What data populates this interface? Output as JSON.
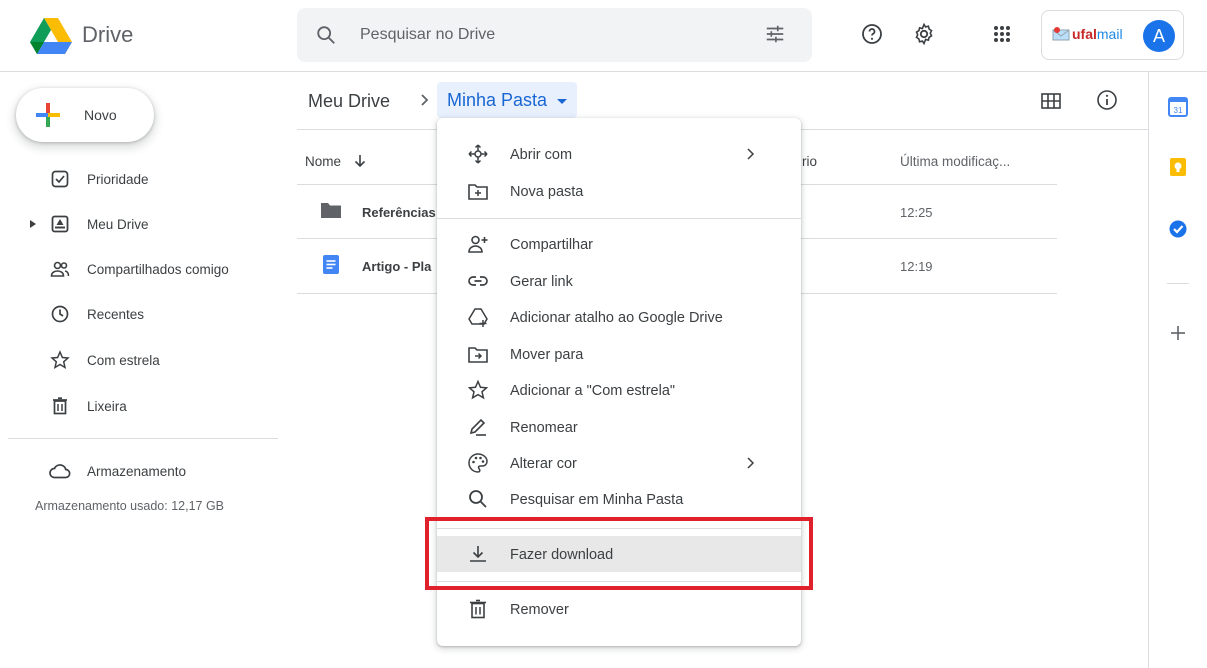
{
  "header": {
    "app_name": "Drive",
    "search_placeholder": "Pesquisar no Drive",
    "account_brand_a": "ufal",
    "account_brand_b": "mail",
    "avatar_letter": "A"
  },
  "sidebar": {
    "new_label": "Novo",
    "items": [
      {
        "label": "Prioridade",
        "icon": "priority-icon"
      },
      {
        "label": "Meu Drive",
        "icon": "my-drive-icon"
      },
      {
        "label": "Compartilhados comigo",
        "icon": "shared-icon"
      },
      {
        "label": "Recentes",
        "icon": "clock-icon"
      },
      {
        "label": "Com estrela",
        "icon": "star-icon"
      },
      {
        "label": "Lixeira",
        "icon": "trash-icon"
      },
      {
        "label": "Armazenamento",
        "icon": "cloud-icon"
      }
    ],
    "storage_text": "Armazenamento usado: 12,17 GB"
  },
  "breadcrumb": {
    "root": "Meu Drive",
    "current": "Minha Pasta"
  },
  "table": {
    "col_name": "Nome",
    "col_owner_partial": "rio",
    "col_modified": "Última modificaç...",
    "rows": [
      {
        "name": "Referências",
        "time": "12:25",
        "icon": "folder-icon"
      },
      {
        "name": "Artigo - Pla",
        "time": "12:19",
        "icon": "doc-icon"
      }
    ]
  },
  "menu": {
    "items": [
      {
        "label": "Abrir com",
        "icon": "open-with-icon",
        "submenu": true
      },
      {
        "label": "Nova pasta",
        "icon": "new-folder-icon"
      },
      {
        "label": "Compartilhar",
        "icon": "share-icon"
      },
      {
        "label": "Gerar link",
        "icon": "link-icon"
      },
      {
        "label": "Adicionar atalho ao Google Drive",
        "icon": "shortcut-icon"
      },
      {
        "label": "Mover para",
        "icon": "move-icon"
      },
      {
        "label": "Adicionar a \"Com estrela\"",
        "icon": "star-icon"
      },
      {
        "label": "Renomear",
        "icon": "rename-icon"
      },
      {
        "label": "Alterar cor",
        "icon": "palette-icon",
        "submenu": true
      },
      {
        "label": "Pesquisar em Minha Pasta",
        "icon": "search-icon"
      },
      {
        "label": "Fazer download",
        "icon": "download-icon"
      },
      {
        "label": "Remover",
        "icon": "trash-icon"
      }
    ]
  },
  "colors": {
    "accent": "#1a73e8",
    "highlight_border": "#e0202a"
  }
}
